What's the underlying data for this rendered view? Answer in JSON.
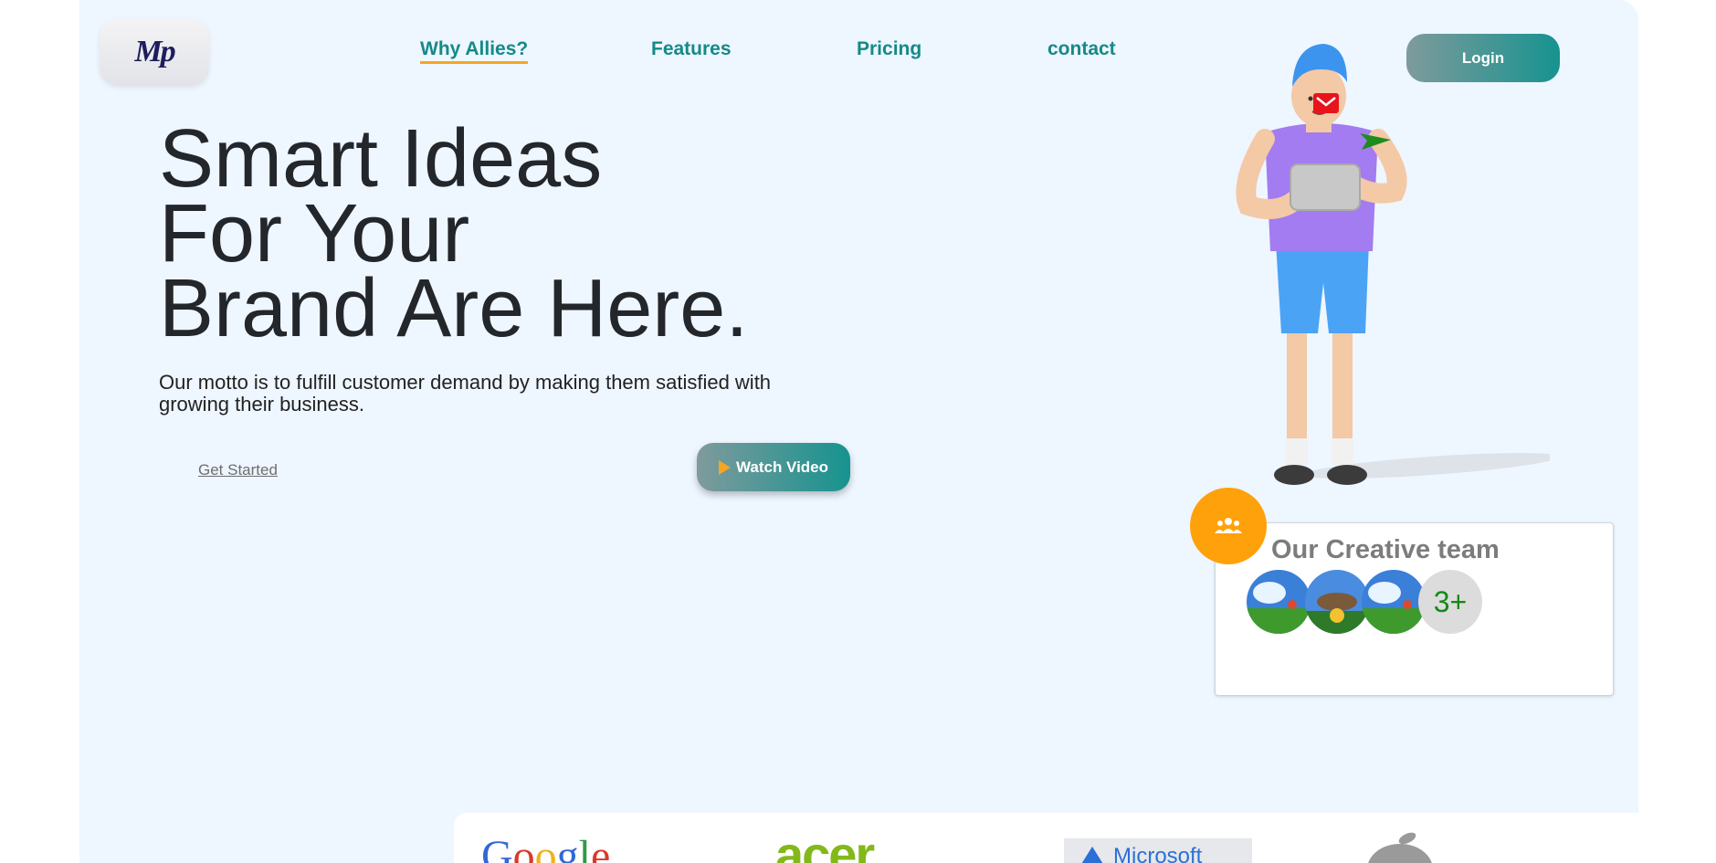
{
  "logo": {
    "text": "Mp"
  },
  "nav": {
    "items": [
      {
        "label": "Why Allies?",
        "active": true
      },
      {
        "label": "Features",
        "active": false
      },
      {
        "label": "Pricing",
        "active": false
      },
      {
        "label": "contact",
        "active": false
      }
    ],
    "login_label": "Login"
  },
  "hero": {
    "title_lines": [
      "Smart Ideas",
      "For Your",
      "Brand Are Here."
    ],
    "subtitle": "Our motto is to fulfill customer demand by making them satisfied with growing their business.",
    "get_started_label": "Get Started",
    "watch_video_label": "Watch Video"
  },
  "team": {
    "title": "Our Creative team",
    "more_count": "3+"
  },
  "brands": [
    "Google",
    "acer",
    "Microsoft",
    "apple-logo"
  ],
  "colors": {
    "accent_teal": "#148a87",
    "accent_orange": "#ffa10a",
    "background": "#eef6ff"
  },
  "icons": [
    "play-icon",
    "team-group-icon",
    "mail-icon",
    "send-arrow-icon"
  ]
}
